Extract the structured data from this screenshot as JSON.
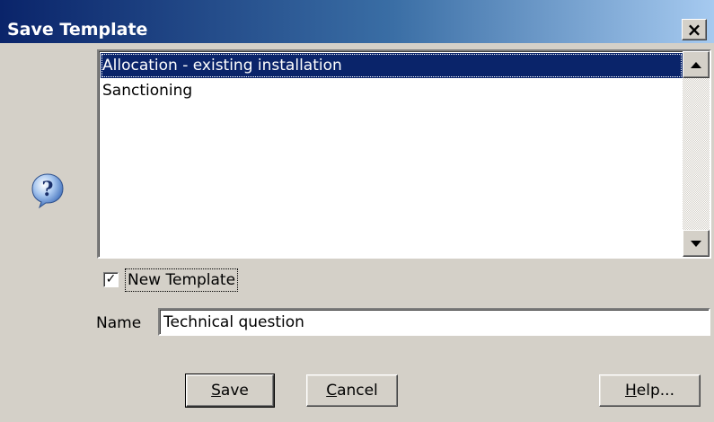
{
  "window": {
    "title": "Save Template",
    "close_glyph": "×"
  },
  "icon": {
    "name": "question-icon"
  },
  "template_list": {
    "items": [
      {
        "label": "Allocation - existing installation",
        "selected": true
      },
      {
        "label": "Sanctioning",
        "selected": false
      }
    ]
  },
  "new_template": {
    "label": "New Template",
    "checked": true,
    "check_glyph": "✓"
  },
  "name_field": {
    "label": "Name",
    "value": "Technical question"
  },
  "buttons": {
    "save": "Save",
    "cancel": "Cancel",
    "help": "Help..."
  },
  "colors": {
    "titlebar_start": "#0a246a",
    "titlebar_end": "#a6caf0",
    "selection": "#0a246a",
    "face": "#d4d0c8"
  }
}
